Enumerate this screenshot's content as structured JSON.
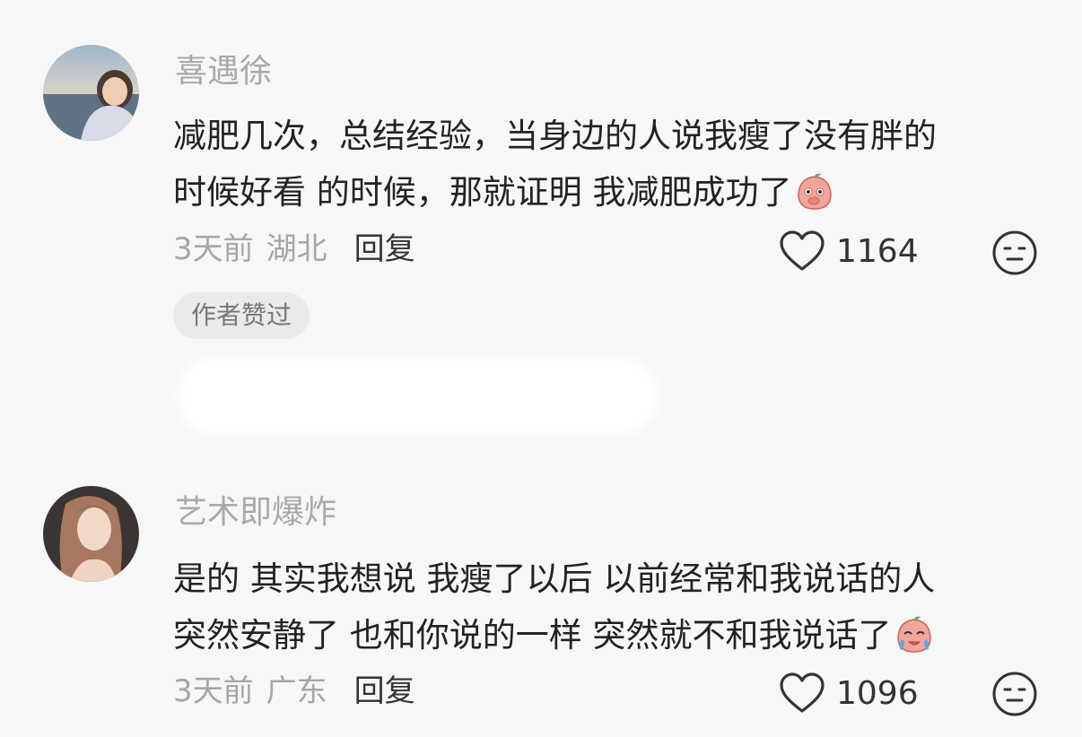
{
  "comments": [
    {
      "username": "喜遇徐",
      "text_lines": [
        "减肥几次，总结经验，当身边的人说我瘦了没有胖的",
        "时候好看 的时候，那就证明 我减肥成功了"
      ],
      "emoji": "shy-peach-emoji",
      "time": "3天前",
      "location": "湖北",
      "reply_label": "回复",
      "likes": "1164",
      "badge": "作者赞过"
    },
    {
      "username": "艺术即爆炸",
      "text_lines": [
        "是的 其实我想说 我瘦了以后 以前经常和我说话的人",
        "突然安静了 也和你说的一样 突然就不和我说话了"
      ],
      "emoji": "crying-peach-emoji",
      "time": "3天前",
      "location": "广东",
      "reply_label": "回复",
      "likes": "1096"
    }
  ],
  "colors": {
    "background": "#f7f7f7",
    "username": "#a9a9a9",
    "text": "#222222",
    "meta": "#a6a6a6",
    "emoji_pink": "#f3a59b"
  }
}
